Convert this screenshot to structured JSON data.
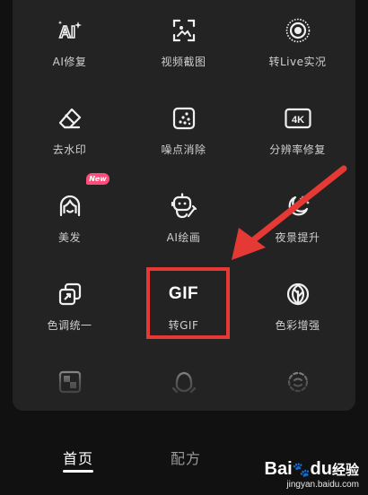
{
  "tools": [
    {
      "id": "ai-repair",
      "label": "AI修复",
      "icon": "ai-sparkle-icon"
    },
    {
      "id": "video-screenshot",
      "label": "视频截图",
      "icon": "video-frame-icon"
    },
    {
      "id": "live-photo",
      "label": "转Live实况",
      "icon": "live-photo-icon"
    },
    {
      "id": "watermark",
      "label": "去水印",
      "icon": "eraser-icon"
    },
    {
      "id": "denoise",
      "label": "噪点消除",
      "icon": "noise-icon"
    },
    {
      "id": "upscale",
      "label": "分辨率修复",
      "icon": "4k-icon",
      "icon_text": "4K"
    },
    {
      "id": "hair",
      "label": "美发",
      "icon": "hair-face-icon",
      "badge": "New"
    },
    {
      "id": "ai-paint",
      "label": "AI绘画",
      "icon": "robot-paint-icon"
    },
    {
      "id": "night",
      "label": "夜景提升",
      "icon": "moon-sparkle-icon"
    },
    {
      "id": "color-unify",
      "label": "色调统一",
      "icon": "color-transfer-icon"
    },
    {
      "id": "to-gif",
      "label": "转GIF",
      "icon": "gif-icon",
      "icon_text": "GIF"
    },
    {
      "id": "color-enhance",
      "label": "色彩增强",
      "icon": "leaf-icon"
    }
  ],
  "partial_row_icons": [
    "mosaic-icon",
    "face-slim-icon",
    "face-shape-icon"
  ],
  "nav": {
    "home": "首页",
    "recipe": "配方"
  },
  "watermark": {
    "logo": "Bai",
    "logo_suffix": "du",
    "logo_cn": "经验",
    "url": "jingyan.baidu.com"
  },
  "colors": {
    "highlight": "#e53935",
    "arrow": "#e53935",
    "badge": "#ff4d7a",
    "panel": "#232323"
  }
}
